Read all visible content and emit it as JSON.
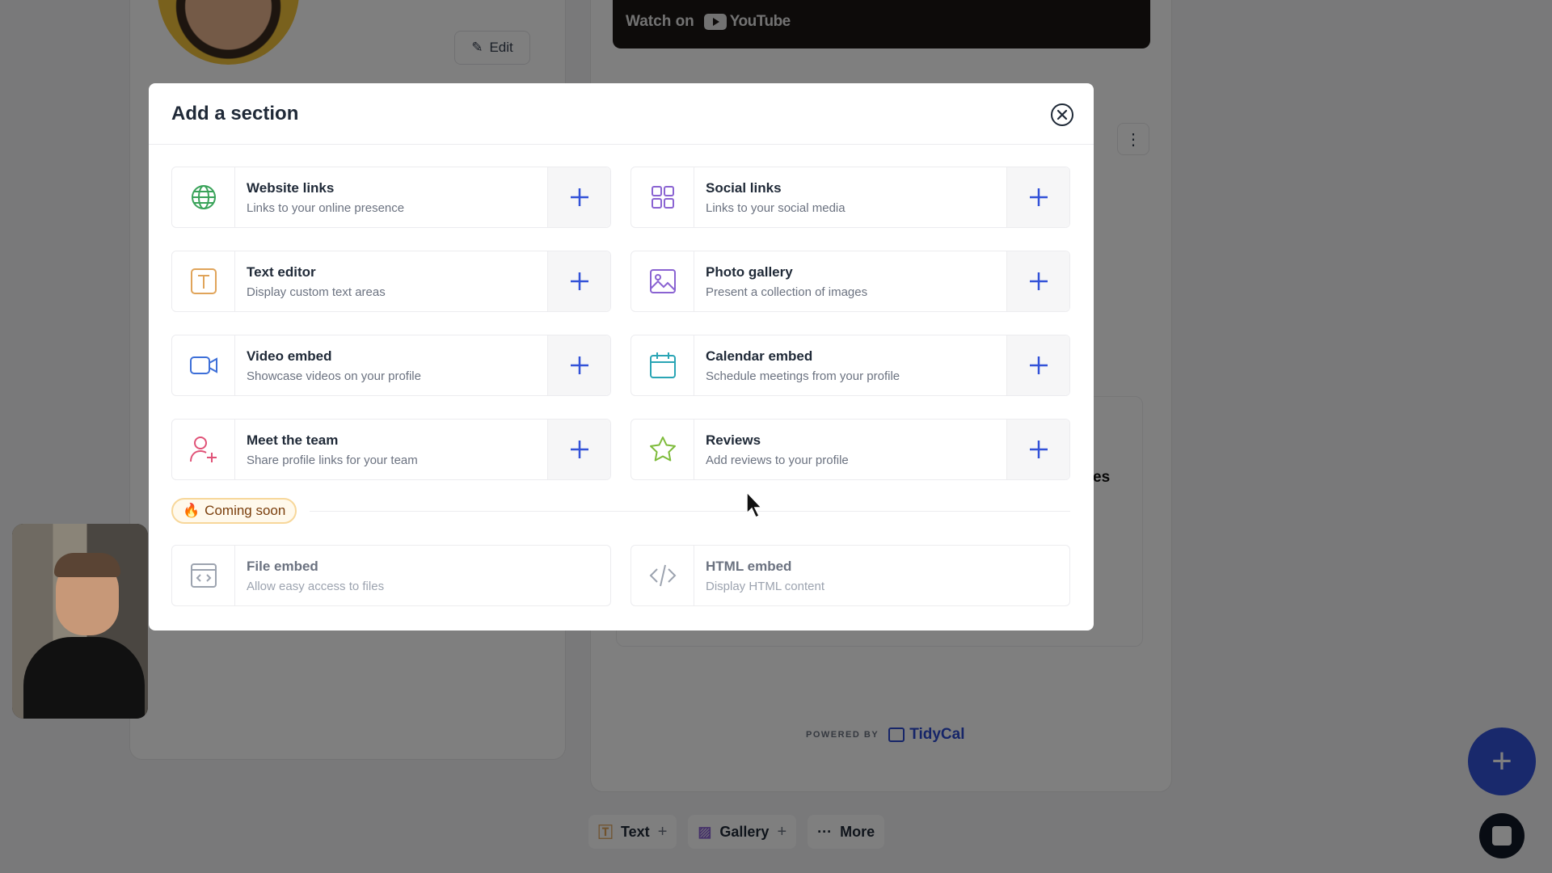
{
  "background": {
    "edit_label": "Edit",
    "video_watch_on": "Watch on",
    "video_brand": "YouTube",
    "powered_by": "POWERED BY",
    "powered_brand": "TidyCal",
    "partial_text": "es",
    "toolbar": [
      {
        "label": "Text",
        "icon": "text-icon",
        "color": "#e0a45a"
      },
      {
        "label": "Gallery",
        "icon": "gallery-icon",
        "color": "#8a63d2"
      },
      {
        "label": "More",
        "icon": "more-icon",
        "color": "#374151"
      }
    ],
    "fab_label": "+"
  },
  "modal": {
    "title": "Add a section",
    "close_icon": "close-icon",
    "sections": [
      {
        "title": "Website links",
        "description": "Links to your online presence",
        "icon": "globe-icon",
        "color": "#3aa35a"
      },
      {
        "title": "Social links",
        "description": "Links to your social media",
        "icon": "grid-icon",
        "color": "#8a63d2"
      },
      {
        "title": "Text editor",
        "description": "Display custom text areas",
        "icon": "text-icon",
        "color": "#e0a45a"
      },
      {
        "title": "Photo gallery",
        "description": "Present a collection of images",
        "icon": "image-icon",
        "color": "#8a63d2"
      },
      {
        "title": "Video embed",
        "description": "Showcase videos on your profile",
        "icon": "video-icon",
        "color": "#3d6fd8"
      },
      {
        "title": "Calendar embed",
        "description": "Schedule meetings from your profile",
        "icon": "calendar-icon",
        "color": "#2aa5b5"
      },
      {
        "title": "Meet the team",
        "description": "Share profile links for your team",
        "icon": "user-plus-icon",
        "color": "#e05277"
      },
      {
        "title": "Reviews",
        "description": "Add reviews to your profile",
        "icon": "star-icon",
        "color": "#7dbb3a"
      }
    ],
    "coming_soon_label": "Coming soon",
    "coming_soon": [
      {
        "title": "File embed",
        "description": "Allow easy access to files",
        "icon": "file-code-icon"
      },
      {
        "title": "HTML embed",
        "description": "Display HTML content",
        "icon": "code-icon"
      }
    ],
    "add_color": "#3352d8"
  }
}
